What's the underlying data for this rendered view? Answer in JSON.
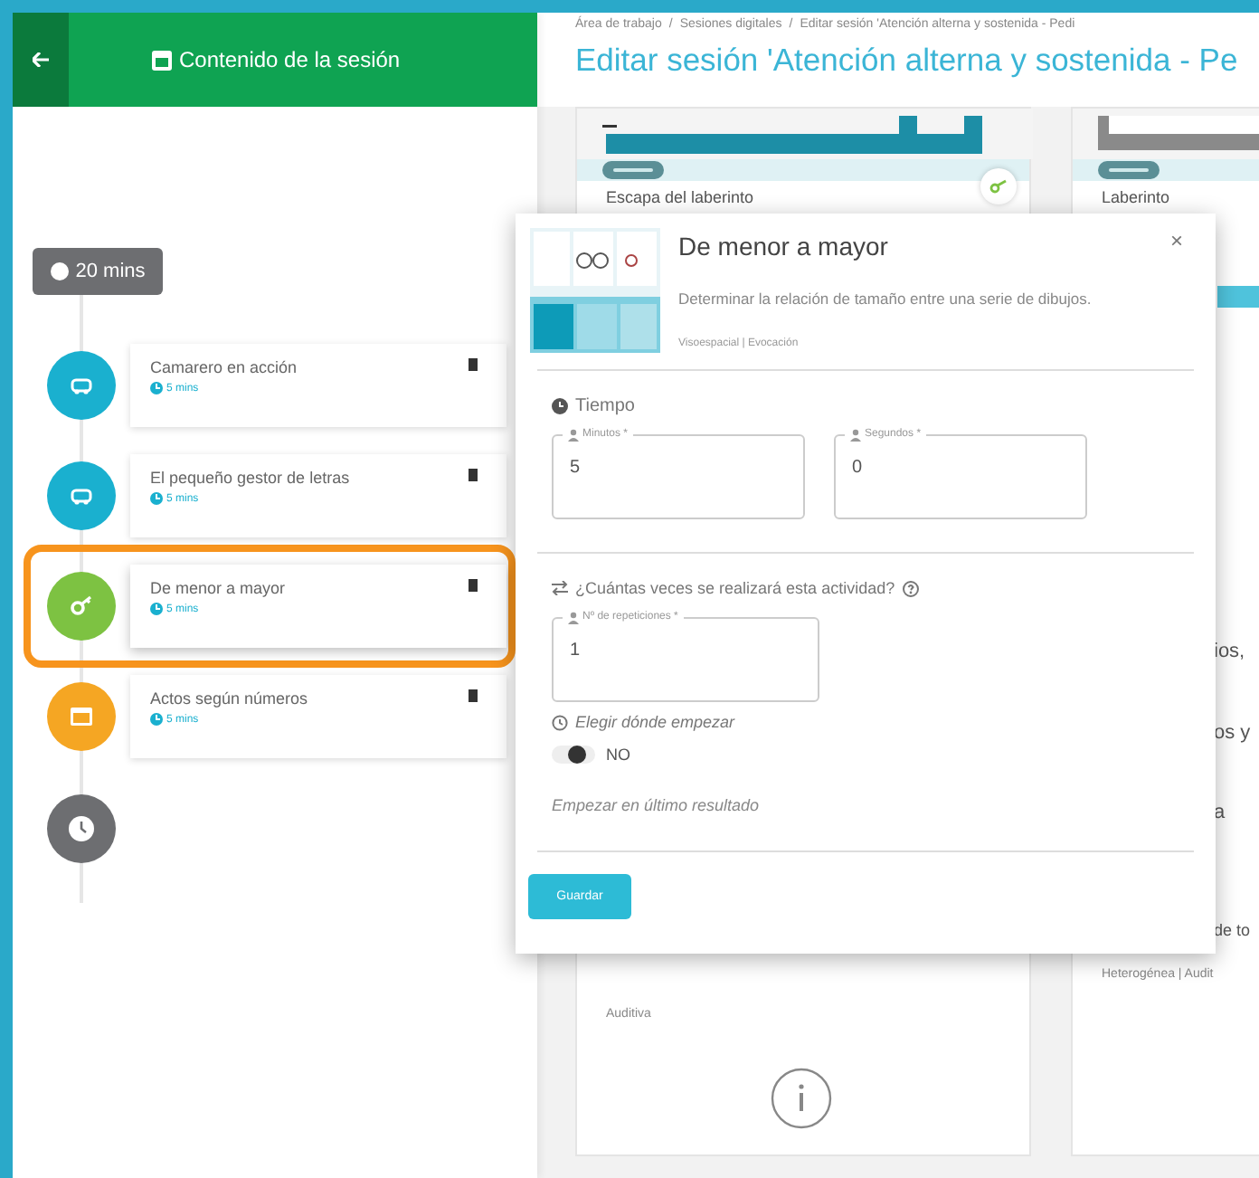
{
  "sidebar": {
    "title": "Contenido de la sesión",
    "total_time": "20 mins",
    "activities": [
      {
        "title": "Camarero en acción",
        "duration": "5 mins",
        "color": "#1ab0cf",
        "kind": "car",
        "selected": false
      },
      {
        "title": "El pequeño gestor de letras",
        "duration": "5 mins",
        "color": "#1ab0cf",
        "kind": "car",
        "selected": false
      },
      {
        "title": "De menor a mayor",
        "duration": "5 mins",
        "color": "#7dc242",
        "kind": "key",
        "selected": true
      },
      {
        "title": "Actos según números",
        "duration": "5 mins",
        "color": "#f5a623",
        "kind": "window",
        "selected": false
      }
    ]
  },
  "header": {
    "breadcrumb": [
      "Área de trabajo",
      "Sesiones digitales",
      "Editar sesión 'Atención alterna y sostenida - Pedi"
    ],
    "separator": "/",
    "title": "Editar sesión 'Atención alterna y sostenida - Pe"
  },
  "cards": [
    {
      "title": "Escapa del laberinto",
      "tags": "Auditiva"
    },
    {
      "title": "Laberinto",
      "lines": [
        "ios,",
        "os y",
        "a",
        "de to"
      ],
      "tags": "Heterogénea | Audit"
    }
  ],
  "modal": {
    "title": "De menor a mayor",
    "description": "Determinar la relación de tamaño entre una serie de dibujos.",
    "tags": "Visoespacial | Evocación",
    "close": "×",
    "time_label": "Tiempo",
    "time_fields": [
      {
        "label": "Minutos *",
        "value": "5"
      },
      {
        "label": "Segundos *",
        "value": "0"
      }
    ],
    "repeat_label": "¿Cuántas veces se realizará esta actividad?",
    "repeat_field": {
      "label": "Nº de repeticiones *",
      "value": "1"
    },
    "start_label": "Elegir dónde empezar",
    "start_toggle": {
      "on": false,
      "label": "NO"
    },
    "start_hint": "Empezar en último resultado",
    "save_button": "Guardar"
  }
}
